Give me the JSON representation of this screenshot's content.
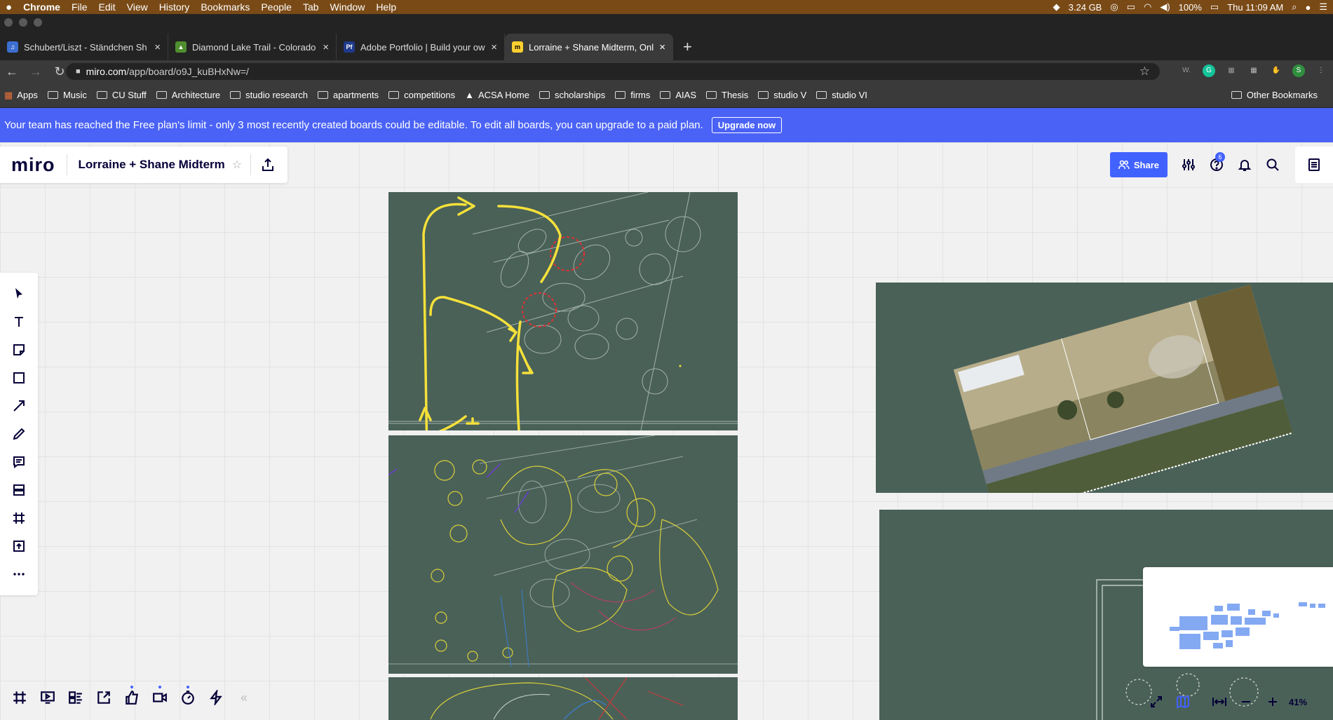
{
  "menubar": {
    "app_name": "Chrome",
    "items": [
      "File",
      "Edit",
      "View",
      "History",
      "Bookmarks",
      "People",
      "Tab",
      "Window",
      "Help"
    ],
    "memory": "3.24 GB",
    "battery": "100%",
    "clock": "Thu 11:09 AM"
  },
  "tabs": [
    {
      "title": "Schubert/Liszt - Ständchen Sh",
      "favicon_color": "#3d6fd1"
    },
    {
      "title": "Diamond Lake Trail - Colorado",
      "favicon_color": "#4f8f2f"
    },
    {
      "title": "Adobe Portfolio | Build your ow",
      "favicon_color": "#1e3a8a"
    },
    {
      "title": "Lorraine + Shane Midterm, Onli",
      "favicon_color": "#ffd02f"
    }
  ],
  "address": {
    "host": "miro.com",
    "path": "/app/board/o9J_kuBHxNw=/"
  },
  "bookmarks": [
    "Apps",
    "Music",
    "CU Stuff",
    "Architecture",
    "studio research",
    "apartments",
    "competitions",
    "ACSA Home",
    "scholarships",
    "firms",
    "AIAS",
    "Thesis",
    "studio V",
    "studio VI"
  ],
  "other_bookmarks": "Other Bookmarks",
  "banner": {
    "text": "Your team has reached the Free plan's limit - only 3 most recently created boards could be editable. To edit all boards, you can upgrade to a paid plan.",
    "button": "Upgrade now"
  },
  "board": {
    "logo": "miro",
    "title": "Lorraine + Shane Midterm",
    "share_label": "Share",
    "notifications_count": "6"
  },
  "zoom": "41%",
  "colors": {
    "brand_blue": "#4262ff",
    "banner_blue": "#4a62f5",
    "frame_green": "#4a6158",
    "annotation_yellow": "#f5e13a",
    "annotation_red": "#e03030"
  },
  "left_tools": [
    "select-icon",
    "text-icon",
    "sticky-note-icon",
    "shape-icon",
    "arrow-icon",
    "pen-icon",
    "comment-icon",
    "template-icon",
    "frame-icon",
    "upload-icon",
    "more-icon"
  ],
  "bottom_tools": [
    "frames-icon",
    "present-icon",
    "cards-icon",
    "share-screen-icon",
    "voting-icon",
    "video-icon",
    "timer-icon",
    "lightning-icon",
    "collapse-icon"
  ]
}
